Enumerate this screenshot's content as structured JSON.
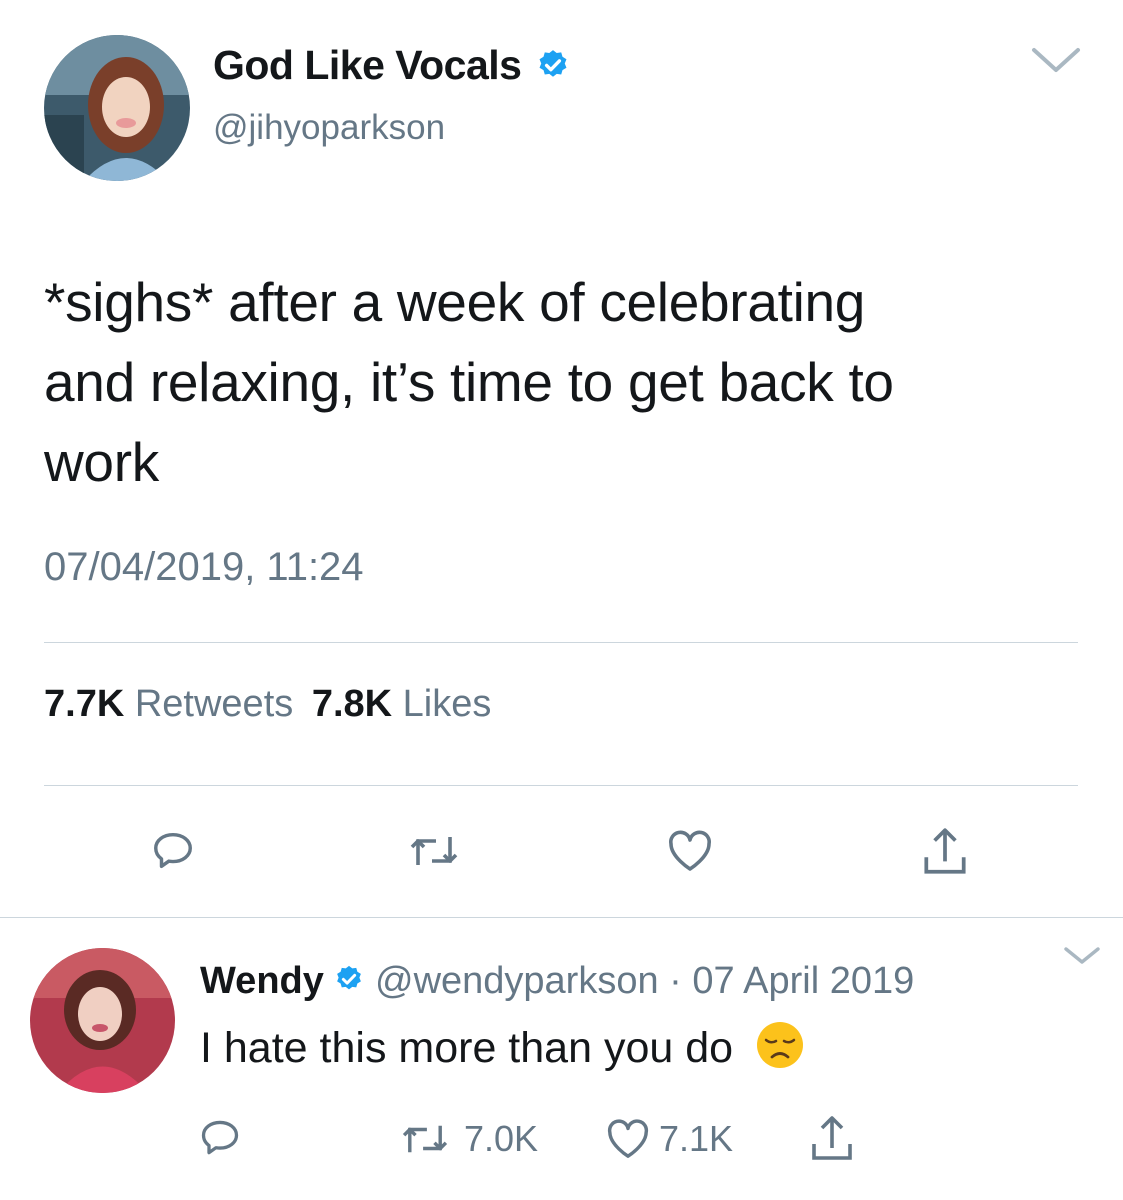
{
  "main_tweet": {
    "display_name": "God Like Vocals",
    "handle": "@jihyoparkson",
    "text_lines": [
      "*sighs* after a week of celebrating",
      "and relaxing, it’s time to get back to",
      "work"
    ],
    "timestamp": "07/04/2019, 11:24",
    "retweet_count": "7.7K",
    "retweet_label": "Retweets",
    "like_count": "7.8K",
    "like_label": "Likes"
  },
  "reply": {
    "display_name": "Wendy",
    "handle": "@wendyparkson",
    "separator": "·",
    "date": "07 April 2019",
    "text": "I hate this more than you do",
    "emoji": "disappointed-face",
    "retweet_count": "7.0K",
    "like_count": "7.1K"
  },
  "colors": {
    "verified": "#1da1f2",
    "icon_gray": "#657786",
    "divider": "#ccd6dd"
  },
  "icons": [
    "chevron-down-icon",
    "reply-icon",
    "retweet-icon",
    "heart-icon",
    "share-icon",
    "verified-badge-icon"
  ]
}
